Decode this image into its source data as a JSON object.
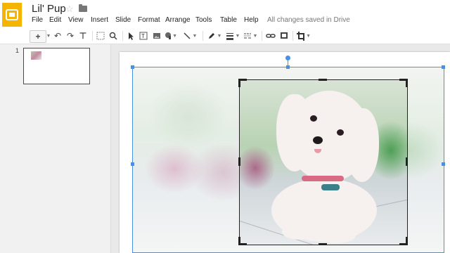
{
  "app": {
    "title": "Lil' Pup",
    "save_status": "All changes saved in Drive"
  },
  "menu": [
    "File",
    "Edit",
    "View",
    "Insert",
    "Slide",
    "Format",
    "Arrange",
    "Tools",
    "Table",
    "Help"
  ],
  "toolbar": {
    "add_label": "+",
    "tools": [
      "undo-icon",
      "redo-icon",
      "paint-format-icon",
      "zoom-fit-icon",
      "zoom-icon",
      "select-icon",
      "textbox-icon",
      "image-icon",
      "shape-icon",
      "line-icon",
      "pen-color-icon",
      "line-weight-icon",
      "line-dash-icon",
      "link-icon",
      "comment-icon",
      "crop-icon"
    ]
  },
  "filmstrip": {
    "slides": [
      {
        "number": "1"
      }
    ]
  },
  "colors": {
    "brand": "#f4b400",
    "selection": "#4a90e2"
  }
}
